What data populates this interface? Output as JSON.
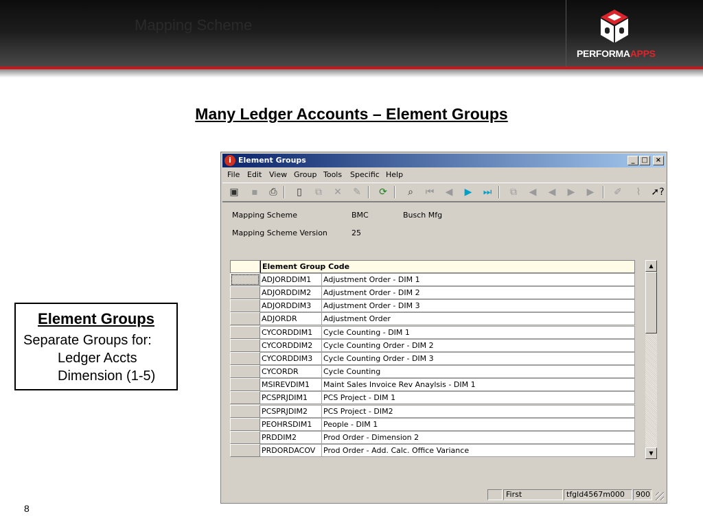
{
  "slide": {
    "header_title": "Mapping Scheme",
    "logo_text_main": "PERFORMA",
    "logo_text_accent": "APPS",
    "title": "Many Ledger Accounts – Element Groups",
    "slide_number": "8",
    "callout": {
      "title": "Element Groups",
      "lines": [
        "Separate Groups for:",
        "Ledger Accts",
        "Dimension (1-5)"
      ]
    }
  },
  "window": {
    "title": "Element Groups",
    "app_icon": "infor-icon",
    "controls": [
      "_",
      "□",
      "×"
    ],
    "menu": [
      "File",
      "Edit",
      "View",
      "Group",
      "Tools",
      "Specific",
      "Help"
    ],
    "toolbar_icons": [
      "save-and-close-icon",
      "save-icon",
      "print-icon",
      "new-icon",
      "copy-icon",
      "delete-icon",
      "text-icon",
      "refresh-icon",
      "find-icon",
      "first-record-icon",
      "previous-record-icon",
      "next-record-icon",
      "last-record-icon",
      "copy-record-icon",
      "first-group-icon",
      "previous-group-icon",
      "next-group-icon",
      "last-group-icon",
      "edit-icon",
      "attachment-icon",
      "help-pointer-icon"
    ],
    "fields": {
      "mapping_scheme_label": "Mapping Scheme",
      "mapping_scheme_code": "BMC",
      "mapping_scheme_desc": "Busch Mfg",
      "version_label": "Mapping Scheme Version",
      "version_value": "25"
    },
    "grid": {
      "header": "Element Group Code",
      "rows": [
        {
          "code": "ADJORDDIM1",
          "desc": "Adjustment Order - DIM 1"
        },
        {
          "code": "ADJORDDIM2",
          "desc": "Adjustment Order - DIM 2"
        },
        {
          "code": "ADJORDDIM3",
          "desc": "Adjustment Order - DIM 3"
        },
        {
          "code": "ADJORDR",
          "desc": "Adjustment Order"
        },
        {
          "code": "CYCORDDIM1",
          "desc": "Cycle Counting - DIM 1"
        },
        {
          "code": "CYCORDDIM2",
          "desc": "Cycle Counting Order - DIM 2"
        },
        {
          "code": "CYCORDDIM3",
          "desc": "Cycle Counting Order - DIM 3"
        },
        {
          "code": "CYCORDR",
          "desc": "Cycle Counting"
        },
        {
          "code": "MSIREVDIM1",
          "desc": "Maint Sales Invoice Rev Anaylsis - DIM 1"
        },
        {
          "code": "PCSPRJDIM1",
          "desc": "PCS Project - DIM 1"
        },
        {
          "code": "PCSPRJDIM2",
          "desc": "PCS Project - DIM2"
        },
        {
          "code": "PEOHRSDIM1",
          "desc": "People - DIM 1"
        },
        {
          "code": "PRDDIM2",
          "desc": "Prod Order - Dimension 2"
        },
        {
          "code": "PRDORDACOV",
          "desc": "Prod Order - Add. Calc. Office Variance"
        }
      ]
    },
    "status": {
      "record_position": "First",
      "session": "tfgld4567m000",
      "company": "900"
    }
  },
  "colors": {
    "brand_red": "#c8161d",
    "titlebar_start": "#0a246a",
    "titlebar_end": "#a6caf0",
    "grid_header": "#fffbe6"
  }
}
